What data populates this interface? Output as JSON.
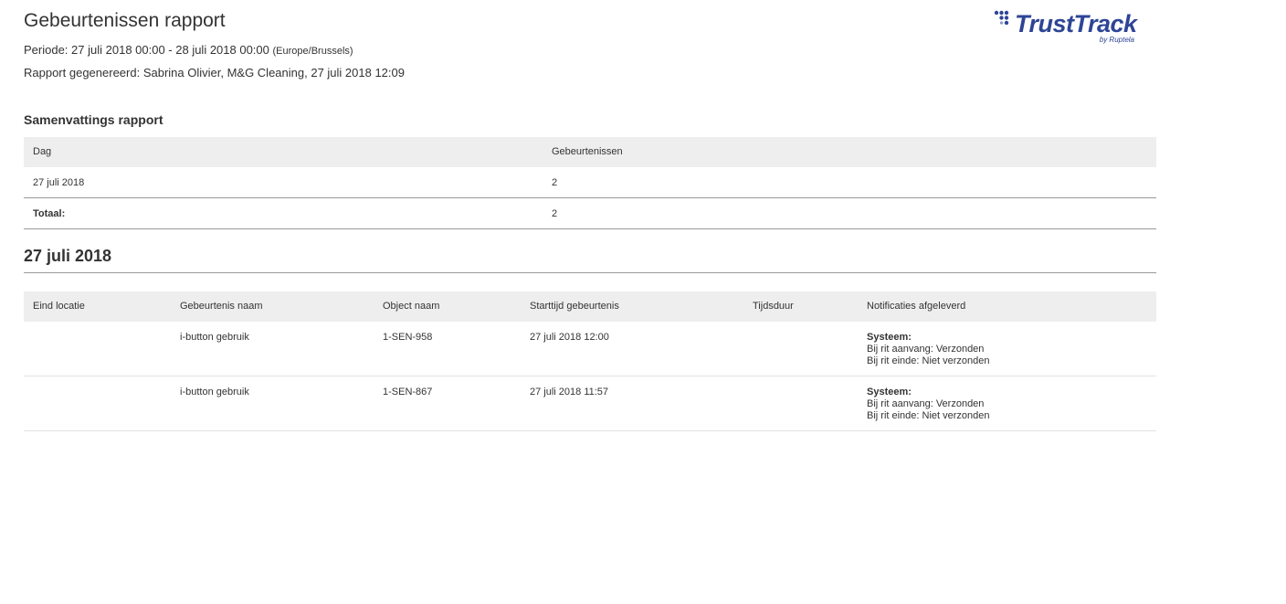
{
  "report": {
    "title": "Gebeurtenissen rapport",
    "period_label": "Periode:",
    "period_value": "27 juli 2018 00:00 - 28 juli 2018 00:00",
    "timezone": "(Europe/Brussels)",
    "generated": "Rapport gegenereerd: Sabrina Olivier, M&G Cleaning, 27 juli 2018 12:09"
  },
  "logo": {
    "name": "TrustTrack",
    "sub": "by Ruptela",
    "color": "#2e4596"
  },
  "summary": {
    "title": "Samenvattings rapport",
    "headers": {
      "dag": "Dag",
      "gebeurtenissen": "Gebeurtenissen"
    },
    "rows": [
      {
        "dag": "27 juli 2018",
        "gebeurtenissen": "2"
      }
    ],
    "total": {
      "label": "Totaal:",
      "value": "2"
    }
  },
  "day_section": {
    "title": "27 juli 2018",
    "headers": {
      "eind_locatie": "Eind locatie",
      "gebeurtenis_naam": "Gebeurtenis naam",
      "object_naam": "Object naam",
      "starttijd": "Starttijd gebeurtenis",
      "tijdsduur": "Tijdsduur",
      "notificaties": "Notificaties afgeleverd"
    },
    "rows": [
      {
        "eind_locatie": "",
        "gebeurtenis_naam": "i-button gebruik",
        "object_naam": "1-SEN-958",
        "starttijd": "27 juli 2018 12:00",
        "tijdsduur": "",
        "notif_title": "Systeem:",
        "notif_line1": "Bij rit aanvang: Verzonden",
        "notif_line2": "Bij rit einde: Niet verzonden"
      },
      {
        "eind_locatie": "",
        "gebeurtenis_naam": "i-button gebruik",
        "object_naam": "1-SEN-867",
        "starttijd": "27 juli 2018 11:57",
        "tijdsduur": "",
        "notif_title": "Systeem:",
        "notif_line1": "Bij rit aanvang: Verzonden",
        "notif_line2": "Bij rit einde: Niet verzonden"
      }
    ]
  }
}
